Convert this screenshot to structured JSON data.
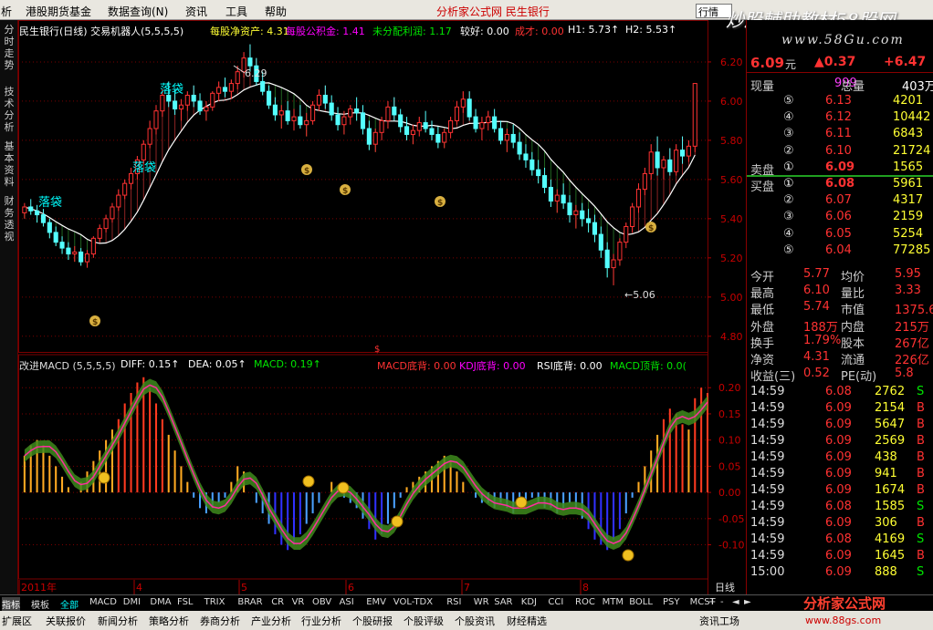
{
  "menu": {
    "items": [
      "析",
      "港股期货基金",
      "数据查询(N)",
      "资讯",
      "工具",
      "帮助"
    ],
    "title": "分析家公式网 民生银行",
    "quick_input": "行情",
    "win_buttons": [
      "_",
      "□",
      "✕"
    ]
  },
  "watermark": {
    "line1": "炒股輔助教材58股网",
    "line2": "www.58Gu.com"
  },
  "left_tabs": [
    "分时走势",
    "技术分析",
    "基本资料",
    "财务透视"
  ],
  "top_indicator": {
    "title": "民生银行(日线) 交易机器人(5,5,5,5)",
    "items": [
      {
        "label": "每股净资产: 4.31",
        "color": "#ffff33"
      },
      {
        "label": "每股公积金: 1.41",
        "color": "#ff00ff"
      },
      {
        "label": "未分配利润: 1.17",
        "color": "#00e600"
      },
      {
        "label": "较好: 0.00",
        "color": "#ffffff"
      },
      {
        "label": "成才: 0.00",
        "color": "#ff3232"
      },
      {
        "label": "H1: 5.73↑",
        "color": "#ffffff"
      },
      {
        "label": "H2: 5.53↑",
        "color": "#ffffff"
      }
    ]
  },
  "annotations": {
    "luodai": "落袋",
    "high_label": "6.29",
    "low_label": "5.06",
    "dollar": "$"
  },
  "macd_indicator": {
    "title": "改进MACD (5,5,5,5)",
    "items": [
      {
        "label": "DIFF: 0.15↑",
        "color": "#ffffff"
      },
      {
        "label": "DEA: 0.05↑",
        "color": "#ffffff"
      },
      {
        "label": "MACD: 0.19↑",
        "color": "#00e600"
      },
      {
        "label": "MACD底背: 0.00",
        "color": "#ff3232"
      },
      {
        "label": "KDJ底背: 0.00",
        "color": "#ff00ff"
      },
      {
        "label": "RSI底背: 0.00",
        "color": "#ffffff"
      },
      {
        "label": "MACD顶背: 0.0(",
        "color": "#00e600"
      }
    ]
  },
  "price_axis": [
    "6.20",
    "6.00",
    "5.80",
    "5.60",
    "5.40",
    "5.20",
    "5.00",
    "4.80"
  ],
  "macd_axis": [
    "0.20",
    "0.15",
    "0.10",
    "0.05",
    "0.00",
    "-0.05",
    "-0.10"
  ],
  "date_axis": {
    "labels": [
      "2011年",
      "4",
      "5",
      "6",
      "7",
      "8"
    ],
    "period": "日线"
  },
  "chart_data": {
    "type": "candlestick",
    "ohlc": [
      [
        5.43,
        5.48,
        5.4,
        5.46
      ],
      [
        5.46,
        5.5,
        5.42,
        5.44
      ],
      [
        5.44,
        5.47,
        5.38,
        5.42
      ],
      [
        5.42,
        5.45,
        5.36,
        5.38
      ],
      [
        5.38,
        5.4,
        5.3,
        5.33
      ],
      [
        5.33,
        5.36,
        5.26,
        5.28
      ],
      [
        5.28,
        5.31,
        5.22,
        5.25
      ],
      [
        5.25,
        5.28,
        5.19,
        5.22
      ],
      [
        5.22,
        5.26,
        5.18,
        5.23
      ],
      [
        5.23,
        5.25,
        5.16,
        5.18
      ],
      [
        5.18,
        5.24,
        5.15,
        5.22
      ],
      [
        5.22,
        5.31,
        5.2,
        5.3
      ],
      [
        5.3,
        5.37,
        5.28,
        5.35
      ],
      [
        5.35,
        5.42,
        5.33,
        5.4
      ],
      [
        5.4,
        5.48,
        5.38,
        5.46
      ],
      [
        5.46,
        5.55,
        5.44,
        5.52
      ],
      [
        5.52,
        5.6,
        5.5,
        5.58
      ],
      [
        5.58,
        5.66,
        5.55,
        5.63
      ],
      [
        5.63,
        5.72,
        5.6,
        5.7
      ],
      [
        5.7,
        5.8,
        5.68,
        5.78
      ],
      [
        5.78,
        5.9,
        5.76,
        5.86
      ],
      [
        5.86,
        5.98,
        5.83,
        5.95
      ],
      [
        5.95,
        6.06,
        5.92,
        6.03
      ],
      [
        6.03,
        6.1,
        5.97,
        6.0
      ],
      [
        6.0,
        6.06,
        5.93,
        5.96
      ],
      [
        5.96,
        6.01,
        5.9,
        5.98
      ],
      [
        5.98,
        6.05,
        5.95,
        6.03
      ],
      [
        6.03,
        6.08,
        5.97,
        6.0
      ],
      [
        6.0,
        6.04,
        5.93,
        5.95
      ],
      [
        5.95,
        6.0,
        5.9,
        5.97
      ],
      [
        5.97,
        6.05,
        5.95,
        6.04
      ],
      [
        6.04,
        6.1,
        6.0,
        6.07
      ],
      [
        6.07,
        6.12,
        6.02,
        6.05
      ],
      [
        6.05,
        6.11,
        6.01,
        6.09
      ],
      [
        6.09,
        6.18,
        6.06,
        6.15
      ],
      [
        6.15,
        6.25,
        6.12,
        6.22
      ],
      [
        6.22,
        6.29,
        6.15,
        6.18
      ],
      [
        6.18,
        6.22,
        6.08,
        6.1
      ],
      [
        6.1,
        6.15,
        6.03,
        6.05
      ],
      [
        6.05,
        6.08,
        5.96,
        5.98
      ],
      [
        5.98,
        6.02,
        5.9,
        5.93
      ],
      [
        5.93,
        5.98,
        5.86,
        5.95
      ],
      [
        5.95,
        6.0,
        5.88,
        5.9
      ],
      [
        5.9,
        5.96,
        5.85,
        5.92
      ],
      [
        5.92,
        5.98,
        5.86,
        5.88
      ],
      [
        5.88,
        5.94,
        5.82,
        5.9
      ],
      [
        5.9,
        6.0,
        5.88,
        5.98
      ],
      [
        5.98,
        6.06,
        5.95,
        6.03
      ],
      [
        6.03,
        6.08,
        5.96,
        5.99
      ],
      [
        5.99,
        6.03,
        5.9,
        5.93
      ],
      [
        5.93,
        5.97,
        5.85,
        5.88
      ],
      [
        5.88,
        5.95,
        5.83,
        5.92
      ],
      [
        5.92,
        5.98,
        5.88,
        5.96
      ],
      [
        5.96,
        6.02,
        5.9,
        5.94
      ],
      [
        5.94,
        5.98,
        5.83,
        5.86
      ],
      [
        5.86,
        5.9,
        5.75,
        5.78
      ],
      [
        5.78,
        5.86,
        5.74,
        5.84
      ],
      [
        5.84,
        5.92,
        5.8,
        5.9
      ],
      [
        5.9,
        6.0,
        5.86,
        5.97
      ],
      [
        5.97,
        6.02,
        5.9,
        5.93
      ],
      [
        5.93,
        5.96,
        5.84,
        5.87
      ],
      [
        5.87,
        5.92,
        5.8,
        5.83
      ],
      [
        5.83,
        5.88,
        5.78,
        5.85
      ],
      [
        5.85,
        5.92,
        5.82,
        5.89
      ],
      [
        5.89,
        5.95,
        5.84,
        5.86
      ],
      [
        5.86,
        5.9,
        5.8,
        5.83
      ],
      [
        5.83,
        5.87,
        5.76,
        5.79
      ],
      [
        5.79,
        5.86,
        5.76,
        5.84
      ],
      [
        5.84,
        5.92,
        5.81,
        5.9
      ],
      [
        5.9,
        6.0,
        5.88,
        5.97
      ],
      [
        5.97,
        6.05,
        5.94,
        6.01
      ],
      [
        6.01,
        6.05,
        5.9,
        5.92
      ],
      [
        5.92,
        5.96,
        5.84,
        5.86
      ],
      [
        5.86,
        5.92,
        5.8,
        5.89
      ],
      [
        5.89,
        5.95,
        5.85,
        5.92
      ],
      [
        5.92,
        5.96,
        5.84,
        5.86
      ],
      [
        5.86,
        5.9,
        5.78,
        5.8
      ],
      [
        5.8,
        5.86,
        5.74,
        5.83
      ],
      [
        5.83,
        5.88,
        5.76,
        5.79
      ],
      [
        5.79,
        5.84,
        5.7,
        5.73
      ],
      [
        5.73,
        5.78,
        5.66,
        5.7
      ],
      [
        5.7,
        5.74,
        5.62,
        5.65
      ],
      [
        5.65,
        5.7,
        5.58,
        5.62
      ],
      [
        5.62,
        5.66,
        5.53,
        5.56
      ],
      [
        5.56,
        5.6,
        5.46,
        5.49
      ],
      [
        5.49,
        5.55,
        5.43,
        5.52
      ],
      [
        5.52,
        5.58,
        5.45,
        5.48
      ],
      [
        5.48,
        5.52,
        5.38,
        5.42
      ],
      [
        5.42,
        5.47,
        5.35,
        5.44
      ],
      [
        5.44,
        5.48,
        5.36,
        5.4
      ],
      [
        5.4,
        5.45,
        5.33,
        5.38
      ],
      [
        5.38,
        5.42,
        5.28,
        5.32
      ],
      [
        5.32,
        5.36,
        5.2,
        5.24
      ],
      [
        5.24,
        5.28,
        5.1,
        5.15
      ],
      [
        5.15,
        5.22,
        5.06,
        5.19
      ],
      [
        5.19,
        5.3,
        5.16,
        5.28
      ],
      [
        5.28,
        5.38,
        5.25,
        5.36
      ],
      [
        5.36,
        5.48,
        5.33,
        5.46
      ],
      [
        5.46,
        5.58,
        5.43,
        5.55
      ],
      [
        5.55,
        5.66,
        5.52,
        5.63
      ],
      [
        5.63,
        5.78,
        5.6,
        5.74
      ],
      [
        5.74,
        5.82,
        5.62,
        5.66
      ],
      [
        5.66,
        5.72,
        5.6,
        5.7
      ],
      [
        5.7,
        5.76,
        5.62,
        5.64
      ],
      [
        5.64,
        5.78,
        5.62,
        5.75
      ],
      [
        5.75,
        5.82,
        5.68,
        5.72
      ],
      [
        5.72,
        5.8,
        5.69,
        5.77
      ],
      [
        5.77,
        6.09,
        5.74,
        6.09
      ]
    ],
    "ylim": [
      4.72,
      6.33
    ],
    "macd_hist": [
      0.07,
      0.09,
      0.1,
      0.09,
      0.07,
      0.05,
      0.03,
      0.01,
      0.0,
      0.02,
      0.04,
      0.06,
      0.08,
      0.1,
      0.12,
      0.14,
      0.17,
      0.19,
      0.21,
      0.22,
      0.2,
      0.17,
      0.14,
      0.11,
      0.08,
      0.05,
      0.02,
      -0.01,
      -0.03,
      -0.04,
      -0.03,
      -0.02,
      -0.01,
      0.02,
      0.05,
      0.04,
      0.0,
      -0.02,
      -0.04,
      -0.06,
      -0.08,
      -0.1,
      -0.11,
      -0.1,
      -0.08,
      -0.06,
      -0.04,
      -0.02,
      0.0,
      0.02,
      0.01,
      -0.01,
      -0.02,
      -0.03,
      -0.05,
      -0.07,
      -0.09,
      -0.08,
      -0.06,
      -0.03,
      -0.01,
      0.01,
      0.02,
      0.03,
      0.04,
      0.05,
      0.06,
      0.07,
      0.06,
      0.04,
      0.02,
      0.0,
      -0.01,
      -0.02,
      -0.02,
      -0.03,
      -0.02,
      -0.03,
      -0.04,
      -0.03,
      -0.02,
      -0.01,
      -0.02,
      -0.03,
      -0.03,
      -0.04,
      -0.03,
      -0.02,
      -0.03,
      -0.05,
      -0.07,
      -0.09,
      -0.1,
      -0.11,
      -0.09,
      -0.07,
      -0.04,
      -0.01,
      0.02,
      0.05,
      0.08,
      0.11,
      0.14,
      0.16,
      0.15,
      0.13,
      0.12,
      0.18,
      0.2,
      0.19
    ],
    "macd_ylim": [
      -0.16,
      0.23
    ]
  },
  "quote": {
    "price": "6.09",
    "unit": "元",
    "change": "▲0.37",
    "pct": "+6.47",
    "rows": [
      {
        "k": "现量",
        "v": "999",
        "k2": "总量",
        "v2": "403万"
      },
      {
        "n": "⑤",
        "p": "6.13",
        "q": "4201"
      },
      {
        "n": "④",
        "p": "6.12",
        "q": "10442"
      },
      {
        "n": "③",
        "p": "6.11",
        "q": "6843"
      },
      {
        "n": "②",
        "p": "6.10",
        "q": "21724"
      },
      {
        "label": "卖盘",
        "n": "①",
        "p": "6.09",
        "q": "1565"
      },
      {
        "label": "买盘",
        "n": "①",
        "p": "6.08",
        "q": "5961"
      },
      {
        "n": "②",
        "p": "6.07",
        "q": "4317"
      },
      {
        "n": "③",
        "p": "6.06",
        "q": "2159"
      },
      {
        "n": "④",
        "p": "6.05",
        "q": "5254"
      },
      {
        "n": "⑤",
        "p": "6.04",
        "q": "77285"
      }
    ],
    "stats": [
      {
        "k": "今开",
        "v": "5.77",
        "k2": "均价",
        "v2": "5.95"
      },
      {
        "k": "最高",
        "v": "6.10",
        "k2": "量比",
        "v2": "3.33"
      },
      {
        "k": "最低",
        "v": "5.74",
        "k2": "市值",
        "v2": "1375.6亿"
      },
      {
        "k": "外盘",
        "v": "188万",
        "k2": "内盘",
        "v2": "215万"
      },
      {
        "k": "换手",
        "v": "1.79%",
        "k2": "股本",
        "v2": "267亿"
      },
      {
        "k": "净资",
        "v": "4.31",
        "k2": "流通",
        "v2": "226亿"
      },
      {
        "k": "收益(三)",
        "v": "0.52",
        "k2": "PE(动)",
        "v2": "5.8"
      }
    ],
    "ticks": [
      {
        "t": "14:59",
        "p": "6.08",
        "v": "2762",
        "s": "S"
      },
      {
        "t": "14:59",
        "p": "6.09",
        "v": "2154",
        "s": "B"
      },
      {
        "t": "14:59",
        "p": "6.09",
        "v": "5647",
        "s": "B"
      },
      {
        "t": "14:59",
        "p": "6.09",
        "v": "2569",
        "s": "B"
      },
      {
        "t": "14:59",
        "p": "6.09",
        "v": "438",
        "s": "B"
      },
      {
        "t": "14:59",
        "p": "6.09",
        "v": "941",
        "s": "B"
      },
      {
        "t": "14:59",
        "p": "6.09",
        "v": "1674",
        "s": "B"
      },
      {
        "t": "14:59",
        "p": "6.08",
        "v": "1585",
        "s": "S"
      },
      {
        "t": "14:59",
        "p": "6.09",
        "v": "306",
        "s": "B"
      },
      {
        "t": "14:59",
        "p": "6.08",
        "v": "4169",
        "s": "S"
      },
      {
        "t": "14:59",
        "p": "6.09",
        "v": "1645",
        "s": "B"
      },
      {
        "t": "15:00",
        "p": "6.09",
        "v": "888",
        "s": "S"
      }
    ]
  },
  "indicator_tabs": [
    "指标",
    "模板",
    "全部",
    "MACD",
    "DMI",
    "DMA",
    "FSL",
    "TRIX",
    "BRAR",
    "CR",
    "VR",
    "OBV",
    "ASI",
    "EMV",
    "VOL-TDX",
    "RSI",
    "WR",
    "SAR",
    "KDJ",
    "CCI",
    "ROC",
    "MTM",
    "BOLL",
    "PSY",
    "MCST"
  ],
  "nav_arrows": [
    "+",
    "-",
    "◄",
    "►"
  ],
  "bottom_tabs": [
    "扩展区",
    "关联报价",
    "新闻分析",
    "策略分析",
    "券商分析",
    "产业分析",
    "行业分析",
    "个股研报",
    "个股评级",
    "个股资讯",
    "财经精选"
  ],
  "bottom_right": "资讯工场",
  "logo": {
    "main": "分析家公式网",
    "url": "www.88gs.com"
  },
  "colors": {
    "up": "#ff3232",
    "down": "#54ffff",
    "ma": "#ffffff",
    "grid": "#7a0000"
  }
}
